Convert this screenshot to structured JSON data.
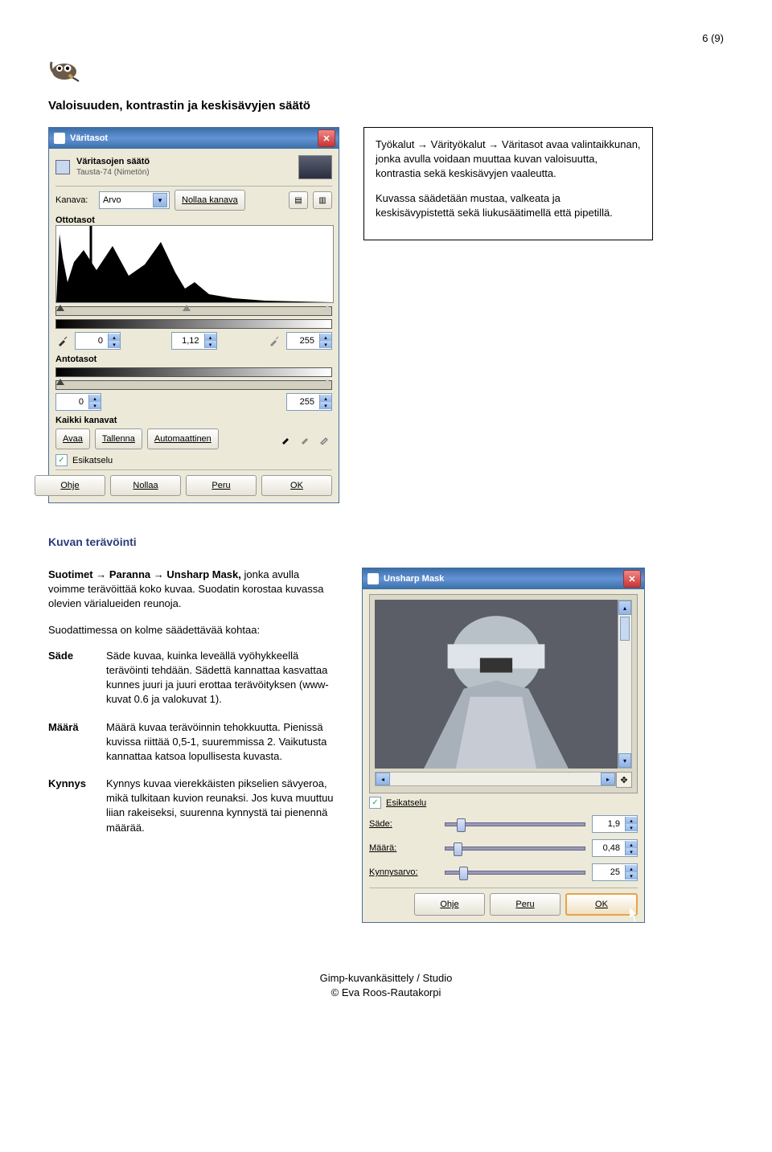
{
  "page_number": "6 (9)",
  "section1_title": "Valoisuuden, kontrastin ja keskisävyjen säätö",
  "levels_dialog": {
    "title": "Väritasot",
    "subtitle_bold": "Väritasojen säätö",
    "subtitle_small": "Tausta-74 (Nimetön)",
    "channel_label": "Kanava:",
    "channel_value": "Arvo",
    "reset_channel": "Nollaa kanava",
    "input_levels": "Ottotasot",
    "low": "0",
    "gamma": "1,12",
    "high": "255",
    "output_levels": "Antotasot",
    "out_low": "0",
    "out_high": "255",
    "all_channels": "Kaikki kanavat",
    "open": "Avaa",
    "save": "Tallenna",
    "auto": "Automaattinen",
    "preview": "Esikatselu",
    "help": "Ohje",
    "reset": "Nollaa",
    "cancel": "Peru",
    "ok": "OK"
  },
  "textbox1": {
    "p1a": "Työkalut ",
    "p1b": " Värityökalut ",
    "p1c": " Väritasot avaa valintaikkunan, jonka avulla voidaan muuttaa kuvan valoisuutta, kontrastia sekä keskisävyjen vaaleutta.",
    "p2": "Kuvassa säädetään mustaa, valkeata ja keskisävypistettä sekä liukusäätimellä että pipetillä."
  },
  "section2_title": "Kuvan terävöinti",
  "textblock2": {
    "intro_a": "Suotimet ",
    "intro_b": " Paranna ",
    "intro_c": " Unsharp Mask,",
    "intro_d": " jonka avulla voimme terävöittää koko kuvaa. Suodatin korostaa kuvassa olevien värialueiden reunoja.",
    "p2": "Suodattimessa on kolme säädettävää kohtaa:",
    "sade_label": "Säde",
    "sade_text": "Säde kuvaa, kuinka leveällä vyöhykkeellä terävöinti tehdään. Sädettä kannattaa kasvattaa kunnes juuri ja juuri erottaa terävöityksen (www-kuvat 0.6 ja valokuvat 1).",
    "maara_label": "Määrä",
    "maara_text": "Määrä kuvaa terävöinnin tehokkuutta. Pienissä kuvissa riittää 0,5-1, suuremmissa 2. Vaikutusta kannattaa katsoa lopullisesta kuvasta.",
    "kynnys_label": "Kynnys",
    "kynnys_text": "Kynnys kuvaa vierekkäisten pikselien sävyeroa, mikä tulkitaan kuvion reunaksi. Jos kuva muuttuu liian rakeiseksi, suurenna kynnystä tai pienennä määrää."
  },
  "unsharp_dialog": {
    "title": "Unsharp Mask",
    "preview": "Esikatselu",
    "sade_label": "Säde:",
    "sade_val": "1,9",
    "maara_label": "Määrä:",
    "maara_val": "0,48",
    "kynnys_label": "Kynnysarvo:",
    "kynnys_val": "25",
    "help": "Ohje",
    "cancel": "Peru",
    "ok": "OK"
  },
  "footer_line1": "Gimp-kuvankäsittely / Studio",
  "footer_line2": "© Eva Roos-Rautakorpi"
}
